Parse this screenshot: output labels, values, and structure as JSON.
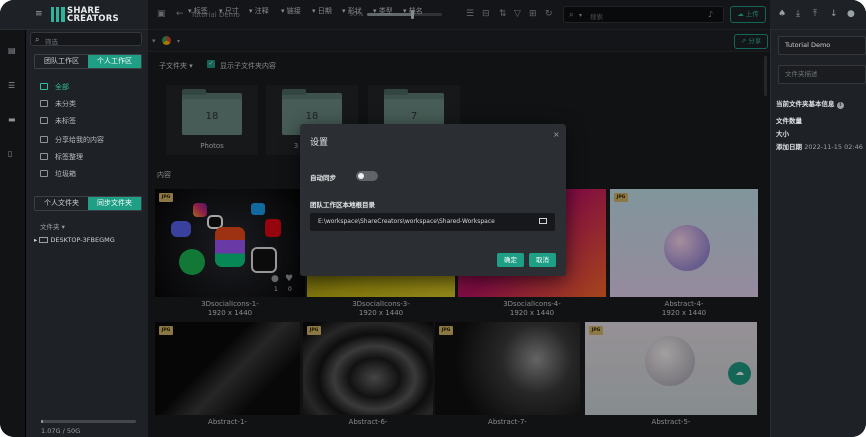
{
  "app": {
    "brand_line1": "SHARE",
    "brand_line2": "CREATORS",
    "workspace_title": "Tutorial Demo"
  },
  "topbar": {
    "zoom": "50%",
    "zoom_fraction": 0.6,
    "search_placeholder": "搜索",
    "upload_label": "上传"
  },
  "filters": {
    "items": [
      "标签",
      "尺寸",
      "注释",
      "链接",
      "日期",
      "形状",
      "类型",
      "档名"
    ],
    "share_label": "分享"
  },
  "left": {
    "search_placeholder": "筛选",
    "tabs": [
      "团队工作区",
      "个人工作区"
    ],
    "nav": [
      "全部",
      "未分类",
      "未标签",
      "分享给我的内容",
      "标签整理",
      "垃圾箱"
    ],
    "tabs2": [
      "个人文件夹",
      "同步文件夹"
    ],
    "folders_label": "文件夹",
    "device": "DESKTOP-3FBEGMG",
    "quota": "1.07G / 50G",
    "quota_fraction": 0.02
  },
  "main": {
    "subfolder_label": "子文件夹",
    "show_sub_label": "显示子文件夹内容",
    "folders": [
      {
        "name": "Photos",
        "count": "18"
      },
      {
        "name": "3",
        "count": "18"
      },
      {
        "name": "",
        "count": "7"
      }
    ],
    "section_label": "内容",
    "items": [
      {
        "badge": "JPG",
        "name": "3DsocialIcons-1-",
        "size": "1920 x 1440",
        "comments": "1",
        "likes": "0"
      },
      {
        "badge": "JPG",
        "name": "3DsocialIcons-3-",
        "size": "1920 x 1440"
      },
      {
        "badge": "JPG",
        "name": "3DsocialIcons-4-",
        "size": "1920 x 1440"
      },
      {
        "badge": "JPG",
        "name": "Abstract-4-",
        "size": "1920 x 1440"
      },
      {
        "badge": "JPG",
        "name": "Abstract-1-"
      },
      {
        "badge": "JPG",
        "name": "Abstract-6-"
      },
      {
        "badge": "JPG",
        "name": "Abstract-7-"
      },
      {
        "badge": "JPG",
        "name": "Abstract-5-"
      }
    ]
  },
  "dialog": {
    "title": "设置",
    "auto_sync_label": "自动同步",
    "auto_sync_on": false,
    "path_label": "团队工作区本地根目录",
    "path_value": "E:\\workspace\\ShareCreators\\workspace\\Shared-Workspace",
    "confirm_label": "确定",
    "cancel_label": "取消"
  },
  "right": {
    "workspace_name": "Tutorial Demo",
    "desc_placeholder": "文件夹描述",
    "info_title": "当前文件夹基本信息",
    "count_label": "文件数量",
    "size_label": "大小",
    "added_label": "添加日期",
    "added_value": "2022-11-15 02:46"
  }
}
